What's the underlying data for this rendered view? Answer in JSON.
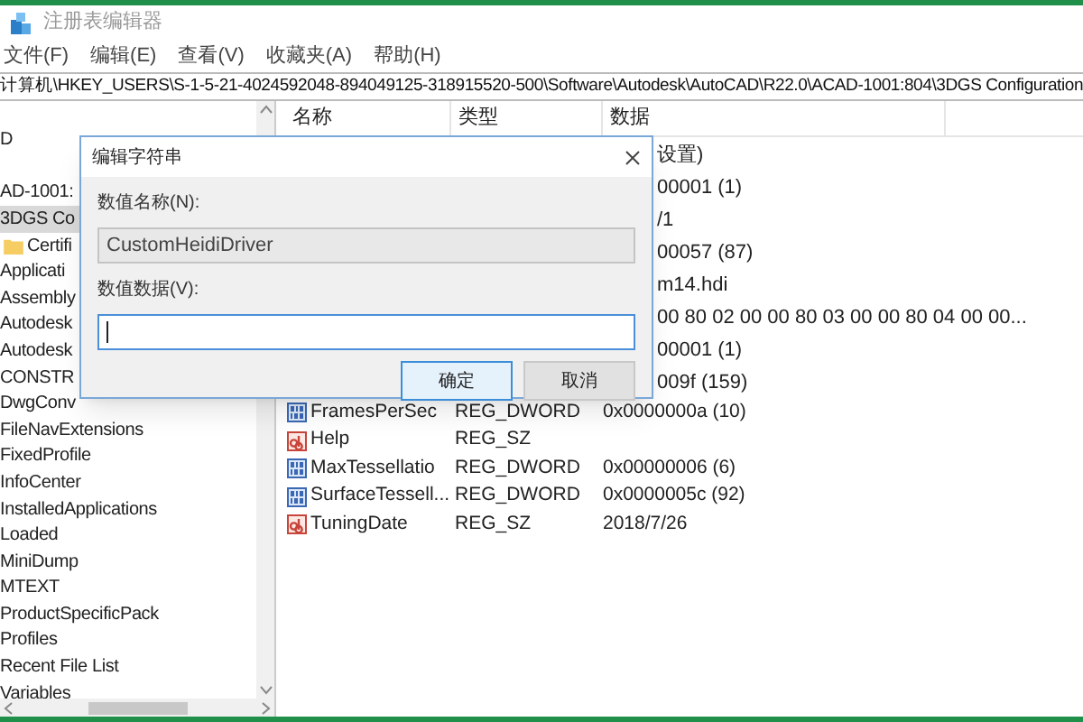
{
  "window": {
    "title": "注册表编辑器"
  },
  "menu": [
    "文件(F)",
    "编辑(E)",
    "查看(V)",
    "收藏夹(A)",
    "帮助(H)"
  ],
  "address": "计算机\\HKEY_USERS\\S-1-5-21-4024592048-894049125-318915520-500\\Software\\Autodesk\\AutoCAD\\R22.0\\ACAD-1001:804\\3DGS Configuration",
  "tree": [
    {
      "label": "D",
      "selected": false,
      "kind": "key"
    },
    {
      "label": "AD-1001:",
      "selected": false,
      "kind": "key"
    },
    {
      "label": "3DGS Co",
      "selected": true,
      "kind": "key"
    },
    {
      "label": "Certifi",
      "selected": false,
      "kind": "folder"
    },
    {
      "label": "Applicati",
      "selected": false,
      "kind": "key"
    },
    {
      "label": "Assembly",
      "selected": false,
      "kind": "key"
    },
    {
      "label": "Autodesk",
      "selected": false,
      "kind": "key"
    },
    {
      "label": "Autodesk",
      "selected": false,
      "kind": "key"
    },
    {
      "label": "CONSTR",
      "selected": false,
      "kind": "key"
    },
    {
      "label": "DwgConv",
      "selected": false,
      "kind": "key"
    },
    {
      "label": "FileNavExtensions",
      "selected": false,
      "kind": "key"
    },
    {
      "label": "FixedProfile",
      "selected": false,
      "kind": "key"
    },
    {
      "label": "InfoCenter",
      "selected": false,
      "kind": "key"
    },
    {
      "label": "InstalledApplications",
      "selected": false,
      "kind": "key"
    },
    {
      "label": "Loaded",
      "selected": false,
      "kind": "key"
    },
    {
      "label": "MiniDump",
      "selected": false,
      "kind": "key"
    },
    {
      "label": "MTEXT",
      "selected": false,
      "kind": "key"
    },
    {
      "label": "ProductSpecificPack",
      "selected": false,
      "kind": "key"
    },
    {
      "label": "Profiles",
      "selected": false,
      "kind": "key"
    },
    {
      "label": "Recent File List",
      "selected": false,
      "kind": "key"
    },
    {
      "label": "Variables",
      "selected": false,
      "kind": "key"
    }
  ],
  "list": {
    "columns": [
      "名称",
      "类型",
      "数据"
    ],
    "rows": [
      {
        "kind": "covered",
        "data": "设置)"
      },
      {
        "kind": "covered",
        "data": "00001 (1)"
      },
      {
        "kind": "covered",
        "data": "/1"
      },
      {
        "kind": "covered",
        "data": "00057 (87)"
      },
      {
        "kind": "covered",
        "data": "m14.hdi"
      },
      {
        "kind": "covered",
        "data": "00 80 02 00 00 80 03 00 00 80 04 00 00..."
      },
      {
        "kind": "covered",
        "data": "00001 (1)"
      },
      {
        "kind": "covered",
        "data": "009f (159)"
      },
      {
        "kind": "dword",
        "name": "FramesPerSec",
        "type": "REG_DWORD",
        "data": "0x0000000a (10)"
      },
      {
        "kind": "string",
        "name": "Help",
        "type": "REG_SZ"
      },
      {
        "kind": "dword",
        "name": "MaxTessellatio",
        "type": "REG_DWORD",
        "data": "0x00000006 (6)"
      },
      {
        "kind": "dword",
        "name": "SurfaceTessell...",
        "type": "REG_DWORD",
        "data": "0x0000005c (92)"
      },
      {
        "kind": "string",
        "name": "TuningDate",
        "type": "REG_SZ",
        "data": "2018/7/26"
      }
    ]
  },
  "dialog": {
    "title": "编辑字符串",
    "name_label": "数值名称(N):",
    "name_value": "CustomHeidiDriver",
    "data_label": "数值数据(V):",
    "buttons": [
      {
        "label": "确定",
        "focused": true
      },
      {
        "label": "取消",
        "focused": false
      }
    ]
  }
}
